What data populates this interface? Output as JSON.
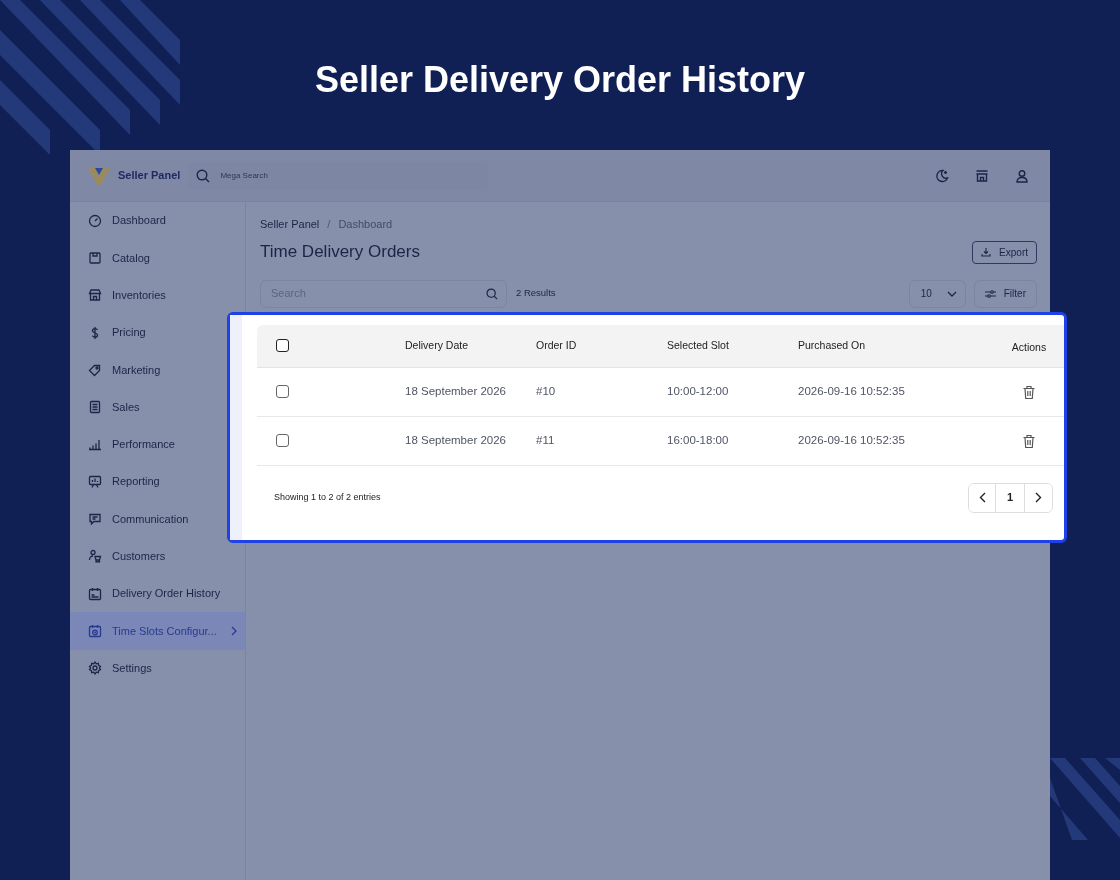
{
  "title": "Seller Delivery Order History",
  "app": {
    "brand": "Seller Panel",
    "search": {
      "placeholder": "Mega Search"
    },
    "sidebar": {
      "items": [
        {
          "label": "Dashboard",
          "selected": false
        },
        {
          "label": "Catalog",
          "selected": false
        },
        {
          "label": "Inventories",
          "selected": false
        },
        {
          "label": "Pricing",
          "selected": false
        },
        {
          "label": "Marketing",
          "selected": false
        },
        {
          "label": "Sales",
          "selected": false
        },
        {
          "label": "Performance",
          "selected": false
        },
        {
          "label": "Reporting",
          "selected": false
        },
        {
          "label": "Communication",
          "selected": false
        },
        {
          "label": "Customers",
          "selected": false
        },
        {
          "label": "Delivery Order History",
          "selected": false
        },
        {
          "label": "Time Slots Configur...",
          "selected": true
        },
        {
          "label": "Settings",
          "selected": false
        }
      ]
    },
    "breadcrumb": [
      "Seller Panel",
      "Dashboard"
    ],
    "breadcrumb_separator": "/",
    "page_title": "Time Delivery Orders",
    "export_button": "Export",
    "table_search": {
      "placeholder": "Search"
    },
    "results": "2 Results",
    "page_size": "10",
    "filter_button": "Filter",
    "table": {
      "select_all_checked": false,
      "columns": [
        "Delivery Date",
        "Order ID",
        "Selected Slot",
        "Purchased On",
        "Actions"
      ],
      "rows": [
        {
          "checked": false,
          "cells": [
            "18 September 2026",
            "#10",
            "10:00-12:00",
            "2026-09-16 10:52:35"
          ]
        },
        {
          "checked": false,
          "cells": [
            "18 September 2026",
            "#11",
            "16:00-18:00",
            "2026-09-16 10:52:35"
          ]
        }
      ]
    },
    "footer": "Showing 1 to 2 of 2 entries",
    "pagination": [
      {
        "label": "1",
        "selected": true
      }
    ]
  }
}
